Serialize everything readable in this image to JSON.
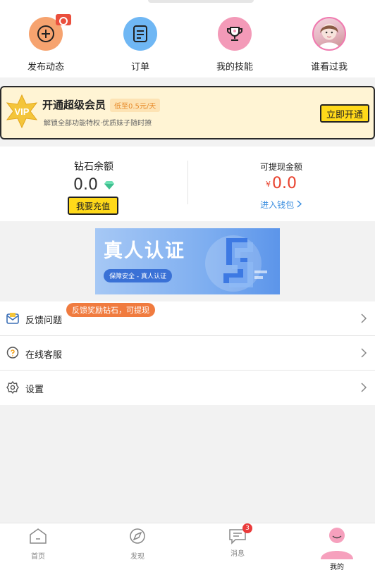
{
  "quick_actions": [
    {
      "label": "发布动态",
      "icon": "plus-circle-icon",
      "color": "#f6a36f"
    },
    {
      "label": "订单",
      "icon": "order-list-icon",
      "color": "#6fb7f4"
    },
    {
      "label": "我的技能",
      "icon": "trophy-icon",
      "color": "#f39ab8"
    },
    {
      "label": "谁看过我",
      "icon": "avatar",
      "color": "#f07ab0"
    }
  ],
  "vip": {
    "badge": "VIP",
    "title": "开通超级会员",
    "tag": "低至0.5元/天",
    "desc": "解锁全部功能特权·优质妹子随时撩",
    "button": "立即开通"
  },
  "wallet": {
    "diamond_title": "钻石余额",
    "diamond_value": "0.0",
    "recharge_button": "我要充值",
    "cash_title": "可提现金额",
    "cash_currency": "¥",
    "cash_value": "0.0",
    "wallet_link": "进入钱包"
  },
  "banner": {
    "title": "真人认证",
    "subtitle": "保障安全 - 真人认证"
  },
  "menu": [
    {
      "label": "反馈问题",
      "icon": "feedback-icon",
      "badge": "反馈奖励钻石，可提现"
    },
    {
      "label": "在线客服",
      "icon": "customer-service-icon"
    },
    {
      "label": "设置",
      "icon": "settings-gear-icon"
    }
  ],
  "tabs": [
    {
      "label": "首页",
      "icon": "home-icon"
    },
    {
      "label": "发现",
      "icon": "discover-icon"
    },
    {
      "label": "消息",
      "icon": "message-icon",
      "badge": "3"
    },
    {
      "label": "我的",
      "icon": "profile-icon"
    }
  ],
  "colors": {
    "accent_yellow": "#ffd91a",
    "price_red": "#e8412d",
    "link_blue": "#3c8fe0",
    "badge_orange": "#f07b3f"
  }
}
